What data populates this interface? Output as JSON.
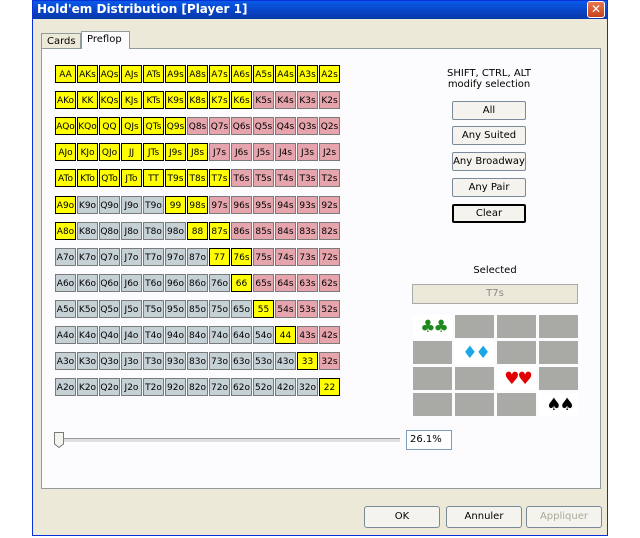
{
  "window": {
    "title": "Hold'em Distribution [Player 1]",
    "close_glyph": "✕"
  },
  "tabs": [
    {
      "label": "Cards",
      "active": false
    },
    {
      "label": "Preflop",
      "active": true
    }
  ],
  "hint": {
    "line1": "SHIFT, CTRL, ALT",
    "line2": "modify selection"
  },
  "buttons": [
    "All",
    "Any Suited",
    "Any Broadway",
    "Any Pair",
    "Clear"
  ],
  "selected": {
    "label": "Selected",
    "value": "T7s"
  },
  "suits": [
    {
      "symbol": "♣♣",
      "color": "#1e8a1e",
      "name": "clubs-icon"
    },
    {
      "symbol": "♦♦",
      "color": "#1aa7e6",
      "name": "diamonds-icon"
    },
    {
      "symbol": "♥♥",
      "color": "#e00000",
      "name": "hearts-icon"
    },
    {
      "symbol": "♠♠",
      "color": "#000000",
      "name": "spades-icon"
    }
  ],
  "colors": {
    "selected": "#ffff00",
    "suited": "#e6a5ad",
    "offsuit": "#c6d1d6",
    "pair": "#ced3d4"
  },
  "slider": {
    "value_label": "26.1%",
    "position_fraction": 0.0
  },
  "footer": {
    "ok": "OK",
    "cancel": "Annuler",
    "apply": "Appliquer",
    "apply_enabled": false
  },
  "hand_matrix": [
    [
      "AA",
      "AKs",
      "AQs",
      "AJs",
      "ATs",
      "A9s",
      "A8s",
      "A7s",
      "A6s",
      "A5s",
      "A4s",
      "A3s",
      "A2s"
    ],
    [
      "AKo",
      "KK",
      "KQs",
      "KJs",
      "KTs",
      "K9s",
      "K8s",
      "K7s",
      "K6s",
      "K5s",
      "K4s",
      "K3s",
      "K2s"
    ],
    [
      "AQo",
      "KQo",
      "QQ",
      "QJs",
      "QTs",
      "Q9s",
      "Q8s",
      "Q7s",
      "Q6s",
      "Q5s",
      "Q4s",
      "Q3s",
      "Q2s"
    ],
    [
      "AJo",
      "KJo",
      "QJo",
      "JJ",
      "JTs",
      "J9s",
      "J8s",
      "J7s",
      "J6s",
      "J5s",
      "J4s",
      "J3s",
      "J2s"
    ],
    [
      "ATo",
      "KTo",
      "QTo",
      "JTo",
      "TT",
      "T9s",
      "T8s",
      "T7s",
      "T6s",
      "T5s",
      "T4s",
      "T3s",
      "T2s"
    ],
    [
      "A9o",
      "K9o",
      "Q9o",
      "J9o",
      "T9o",
      "99",
      "98s",
      "97s",
      "96s",
      "95s",
      "94s",
      "93s",
      "92s"
    ],
    [
      "A8o",
      "K8o",
      "Q8o",
      "J8o",
      "T8o",
      "98o",
      "88",
      "87s",
      "86s",
      "85s",
      "84s",
      "83s",
      "82s"
    ],
    [
      "A7o",
      "K7o",
      "Q7o",
      "J7o",
      "T7o",
      "97o",
      "87o",
      "77",
      "76s",
      "75s",
      "74s",
      "73s",
      "72s"
    ],
    [
      "A6o",
      "K6o",
      "Q6o",
      "J6o",
      "T6o",
      "96o",
      "86o",
      "76o",
      "66",
      "65s",
      "64s",
      "63s",
      "62s"
    ],
    [
      "A5o",
      "K5o",
      "Q5o",
      "J5o",
      "T5o",
      "95o",
      "85o",
      "75o",
      "65o",
      "55",
      "54s",
      "53s",
      "52s"
    ],
    [
      "A4o",
      "K4o",
      "Q4o",
      "J4o",
      "T4o",
      "94o",
      "84o",
      "74o",
      "64o",
      "54o",
      "44",
      "43s",
      "42s"
    ],
    [
      "A3o",
      "K3o",
      "Q3o",
      "J3o",
      "T3o",
      "93o",
      "83o",
      "73o",
      "63o",
      "53o",
      "43o",
      "33",
      "32s"
    ],
    [
      "A2o",
      "K2o",
      "Q2o",
      "J2o",
      "T2o",
      "92o",
      "82o",
      "72o",
      "62o",
      "52o",
      "42o",
      "32o",
      "22"
    ]
  ],
  "selected_hands": [
    "AA",
    "AKs",
    "AQs",
    "AJs",
    "ATs",
    "A9s",
    "A8s",
    "A7s",
    "A6s",
    "A5s",
    "A4s",
    "A3s",
    "A2s",
    "AKo",
    "KK",
    "KQs",
    "KJs",
    "KTs",
    "K9s",
    "K8s",
    "K7s",
    "K6s",
    "AQo",
    "KQo",
    "QQ",
    "QJs",
    "QTs",
    "Q9s",
    "AJo",
    "KJo",
    "QJo",
    "JJ",
    "JTs",
    "J9s",
    "J8s",
    "ATo",
    "KTo",
    "QTo",
    "JTo",
    "TT",
    "T9s",
    "T8s",
    "T7s",
    "A9o",
    "99",
    "98s",
    "A8o",
    "88",
    "87s",
    "77",
    "76s",
    "66",
    "55",
    "44",
    "33",
    "22"
  ]
}
